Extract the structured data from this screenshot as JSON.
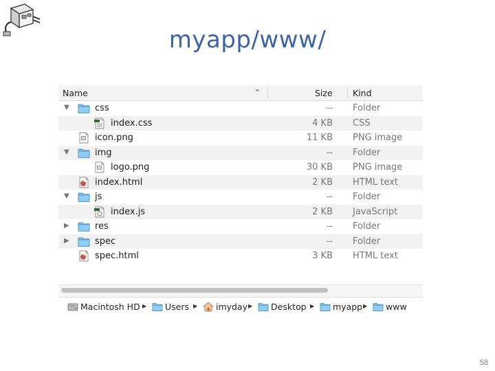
{
  "slide": {
    "title": "myapp/www/",
    "page_number": "58"
  },
  "finder": {
    "columns": {
      "name": "Name",
      "size": "Size",
      "kind": "Kind"
    },
    "rows": [
      {
        "name": "css",
        "size": "--",
        "kind": "Folder",
        "depth": 0,
        "icon": "folder-icon",
        "expanded": true
      },
      {
        "name": "index.css",
        "size": "4 KB",
        "kind": "CSS",
        "depth": 1,
        "icon": "css-file-icon"
      },
      {
        "name": "icon.png",
        "size": "11 KB",
        "kind": "PNG image",
        "depth": 0,
        "icon": "png-file-icon"
      },
      {
        "name": "img",
        "size": "--",
        "kind": "Folder",
        "depth": 0,
        "icon": "folder-icon",
        "expanded": true
      },
      {
        "name": "logo.png",
        "size": "30 KB",
        "kind": "PNG image",
        "depth": 1,
        "icon": "png-file-icon"
      },
      {
        "name": "index.html",
        "size": "2 KB",
        "kind": "HTML text",
        "depth": 0,
        "icon": "html-file-icon"
      },
      {
        "name": "js",
        "size": "--",
        "kind": "Folder",
        "depth": 0,
        "icon": "folder-icon",
        "expanded": true
      },
      {
        "name": "index.js",
        "size": "2 KB",
        "kind": "JavaScript",
        "depth": 1,
        "icon": "js-file-icon"
      },
      {
        "name": "res",
        "size": "--",
        "kind": "Folder",
        "depth": 0,
        "icon": "folder-icon",
        "expanded": false
      },
      {
        "name": "spec",
        "size": "--",
        "kind": "Folder",
        "depth": 0,
        "icon": "folder-icon",
        "expanded": false
      },
      {
        "name": "spec.html",
        "size": "3 KB",
        "kind": "HTML text",
        "depth": 0,
        "icon": "html-file-icon"
      }
    ],
    "path_bar": [
      {
        "label": "Macintosh HD",
        "icon": "hard-drive-icon"
      },
      {
        "label": "Users",
        "icon": "users-folder-icon"
      },
      {
        "label": "imyday",
        "icon": "home-icon"
      },
      {
        "label": "Desktop",
        "icon": "desktop-folder-icon"
      },
      {
        "label": "myapp",
        "icon": "folder-icon"
      },
      {
        "label": "www",
        "icon": "folder-icon"
      }
    ]
  },
  "colors": {
    "title": "#3a64a6",
    "folder": "#7ec0ee",
    "row_alt": "#f2f2f2"
  }
}
